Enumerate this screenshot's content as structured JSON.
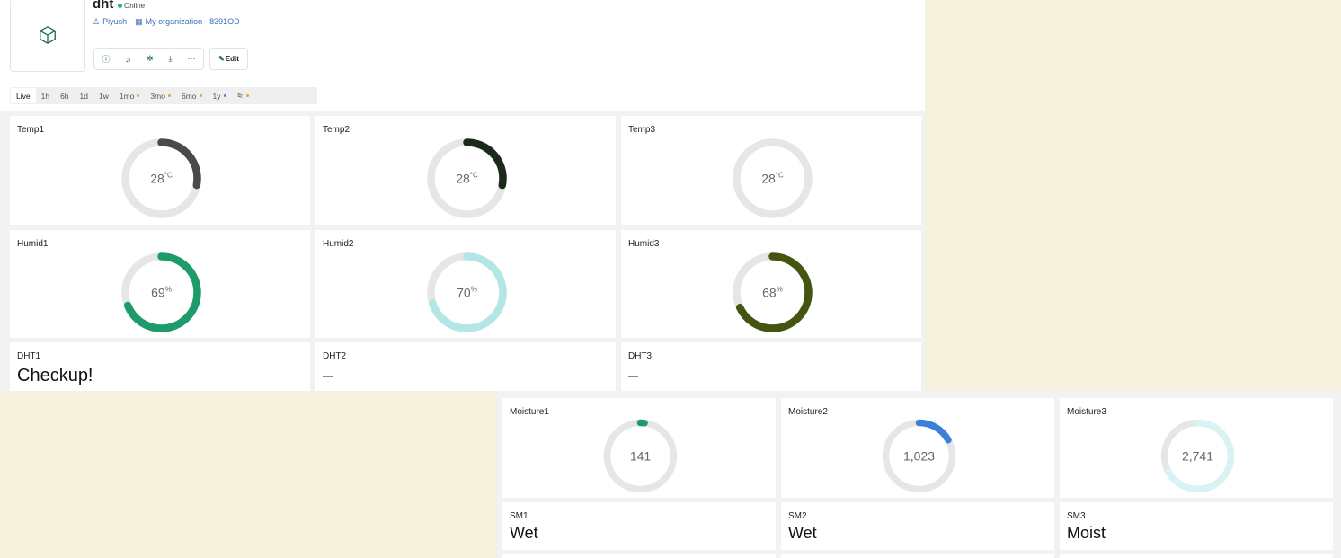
{
  "device": {
    "name": "dht",
    "status": "Online",
    "owner": "Piyush",
    "organization": "My organization - 8391OD",
    "edit_label": "Edit"
  },
  "time_ranges": [
    {
      "label": "Live",
      "active": true
    },
    {
      "label": "1h"
    },
    {
      "label": "6h"
    },
    {
      "label": "1d"
    },
    {
      "label": "1w"
    },
    {
      "label": "1mo",
      "dot": "#e8a33a"
    },
    {
      "label": "3mo",
      "dot": "#e8a33a"
    },
    {
      "label": "6mo",
      "dot": "#e8a33a"
    },
    {
      "label": "1y",
      "dot": "#3a7fd8"
    },
    {
      "label": "⚟",
      "dot": "#e8a33a"
    }
  ],
  "gauges": {
    "temp1": {
      "label": "Temp1",
      "value": "28",
      "unit": "°C",
      "fraction": 0.28,
      "color": "#4a4a4a"
    },
    "temp2": {
      "label": "Temp2",
      "value": "28",
      "unit": "°C",
      "fraction": 0.28,
      "color": "#1b2a1b"
    },
    "temp3": {
      "label": "Temp3",
      "value": "28",
      "unit": "°C",
      "fraction": 0.0,
      "color": "#cccccc"
    },
    "humid1": {
      "label": "Humid1",
      "value": "69",
      "unit": "%",
      "fraction": 0.69,
      "color": "#1e9b6a"
    },
    "humid2": {
      "label": "Humid2",
      "value": "70",
      "unit": "%",
      "fraction": 0.7,
      "color": "#b4e6e8"
    },
    "humid3": {
      "label": "Humid3",
      "value": "68",
      "unit": "%",
      "fraction": 0.68,
      "color": "#44550f"
    },
    "moisture1": {
      "label": "Moisture1",
      "value": "141",
      "unit": "",
      "fraction": 0.02,
      "color": "#1e9b6a"
    },
    "moisture2": {
      "label": "Moisture2",
      "value": "1,023",
      "unit": "",
      "fraction": 0.17,
      "color": "#3a7fd8"
    },
    "moisture3": {
      "label": "Moisture3",
      "value": "2,741",
      "unit": "",
      "fraction": 0.67,
      "color": "#d8f3f3"
    }
  },
  "labels": {
    "dht1": {
      "label": "DHT1",
      "value": "Checkup!"
    },
    "dht2": {
      "label": "DHT2",
      "value": "–"
    },
    "dht3": {
      "label": "DHT3",
      "value": "–"
    },
    "sm1": {
      "label": "SM1",
      "value": "Wet"
    },
    "sm2": {
      "label": "SM2",
      "value": "Wet"
    },
    "sm3": {
      "label": "SM3",
      "value": "Moist"
    }
  }
}
